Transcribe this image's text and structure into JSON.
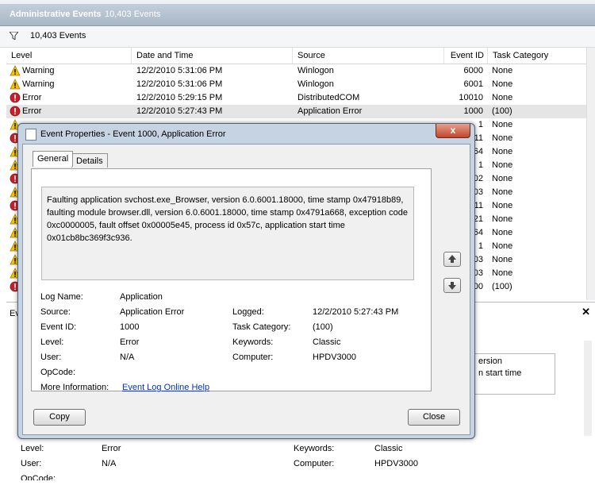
{
  "titlebar": {
    "title": "Administrative Events",
    "count": "10,403 Events"
  },
  "filterbar": {
    "count": "10,403 Events"
  },
  "grid": {
    "columns": [
      "Level",
      "Date and Time",
      "Source",
      "Event ID",
      "Task Category"
    ],
    "rows": [
      {
        "level": "Warning",
        "icon": "warning-icon",
        "date": "12/2/2010 5:31:06 PM",
        "source": "Winlogon",
        "id": "6000",
        "cat": "None"
      },
      {
        "level": "Warning",
        "icon": "warning-icon",
        "date": "12/2/2010 5:31:06 PM",
        "source": "Winlogon",
        "id": "6001",
        "cat": "None"
      },
      {
        "level": "Error",
        "icon": "error-icon",
        "date": "12/2/2010 5:29:15 PM",
        "source": "DistributedCOM",
        "id": "10010",
        "cat": "None"
      },
      {
        "level": "Error",
        "icon": "error-icon",
        "date": "12/2/2010 5:27:43 PM",
        "source": "Application Error",
        "id": "1000",
        "cat": "(100)"
      }
    ],
    "partial_ids": [
      "1",
      "11",
      "64",
      "1",
      "02",
      "03",
      "11",
      "21",
      "64",
      "1",
      "03",
      "03",
      "00"
    ],
    "partial_cats": [
      "None",
      "None",
      "None",
      "None",
      "None",
      "None",
      "None",
      "None",
      "None",
      "None",
      "None",
      "None",
      "(100)"
    ],
    "partial_icons": [
      "warning-icon",
      "error-icon",
      "warning-icon",
      "warning-icon",
      "error-icon",
      "warning-icon",
      "error-icon",
      "warning-icon",
      "warning-icon",
      "warning-icon",
      "warning-icon",
      "warning-icon",
      "error-icon"
    ]
  },
  "lower": {
    "tab_stub": "Ev",
    "box_line1": "ersion",
    "box_line2": "n start time",
    "level_label": "Level:",
    "level_value": "Error",
    "user_label": "User:",
    "user_value": "N/A",
    "keywords_label": "Keywords:",
    "keywords_value": "Classic",
    "computer_label": "Computer:",
    "computer_value": "HPDV3000",
    "opcode_label": "OpCode:"
  },
  "dialog": {
    "title": "Event Properties - Event 1000, Application Error",
    "close_glyph": "x",
    "tabs": [
      "General",
      "Details"
    ],
    "description": "Faulting application svchost.exe_Browser, version 6.0.6001.18000, time stamp 0x47918b89, faulting module browser.dll, version 6.0.6001.18000, time stamp 0x4791a668, exception code 0xc0000005, fault offset 0x00005e45, process id 0x57c, application start time 0x01cb8bc369f3c936.",
    "fields": {
      "log_name_label": "Log Name:",
      "log_name": "Application",
      "source_label": "Source:",
      "source": "Application Error",
      "logged_label": "Logged:",
      "logged": "12/2/2010 5:27:43 PM",
      "event_id_label": "Event ID:",
      "event_id": "1000",
      "task_cat_label": "Task Category:",
      "task_cat": "(100)",
      "level_label": "Level:",
      "level": "Error",
      "keywords_label": "Keywords:",
      "keywords": "Classic",
      "user_label": "User:",
      "user": "N/A",
      "computer_label": "Computer:",
      "computer": "HPDV3000",
      "opcode_label": "OpCode:",
      "more_info_label": "More Information:",
      "more_info_link": "Event Log Online Help"
    },
    "copy_label": "Copy",
    "close_label": "Close"
  }
}
